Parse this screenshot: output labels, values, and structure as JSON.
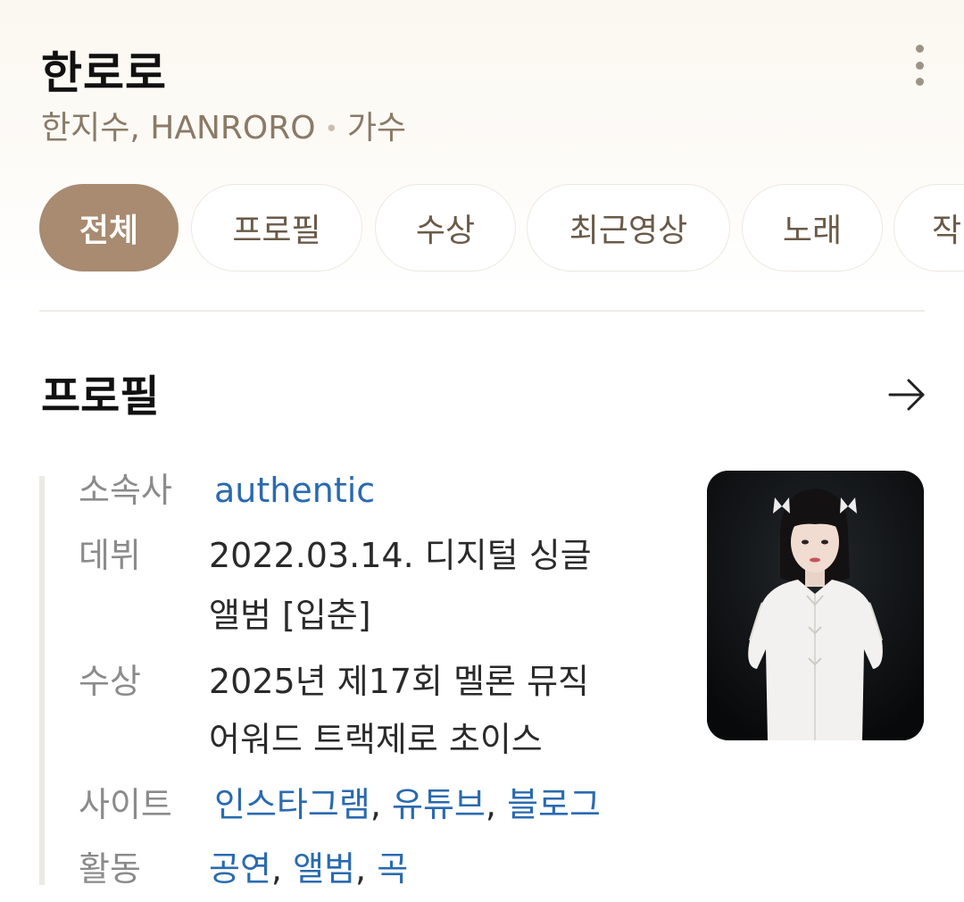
{
  "header": {
    "title": "한로로",
    "subtitle_names": "한지수, HANRORO",
    "subtitle_dot": "•",
    "subtitle_role": "가수"
  },
  "tabs": [
    {
      "label": "전체",
      "active": true
    },
    {
      "label": "프로필",
      "active": false
    },
    {
      "label": "수상",
      "active": false
    },
    {
      "label": "최근영상",
      "active": false
    },
    {
      "label": "노래",
      "active": false
    },
    {
      "label": "작",
      "active": false
    }
  ],
  "profile": {
    "section_title": "프로필",
    "rows": {
      "agency": {
        "label": "소속사",
        "value": "authentic"
      },
      "debut": {
        "label": "데뷔",
        "line1": "2022.03.14. 디지털 싱글",
        "line2": "앨범 [입춘]"
      },
      "award": {
        "label": "수상",
        "line1": "2025년 제17회 멜론 뮤직",
        "line2": "어워드 트랙제로 초이스"
      },
      "sites": {
        "label": "사이트",
        "links": [
          "인스타그램",
          "유튜브",
          "블로그"
        ],
        "separator": ","
      },
      "activity": {
        "label": "활동",
        "links": [
          "공연",
          "앨범",
          "곡"
        ],
        "separator": ","
      }
    }
  },
  "colors": {
    "accent": "#a88b70",
    "link": "#2a6ab0",
    "subtitle": "#8a7a66"
  }
}
